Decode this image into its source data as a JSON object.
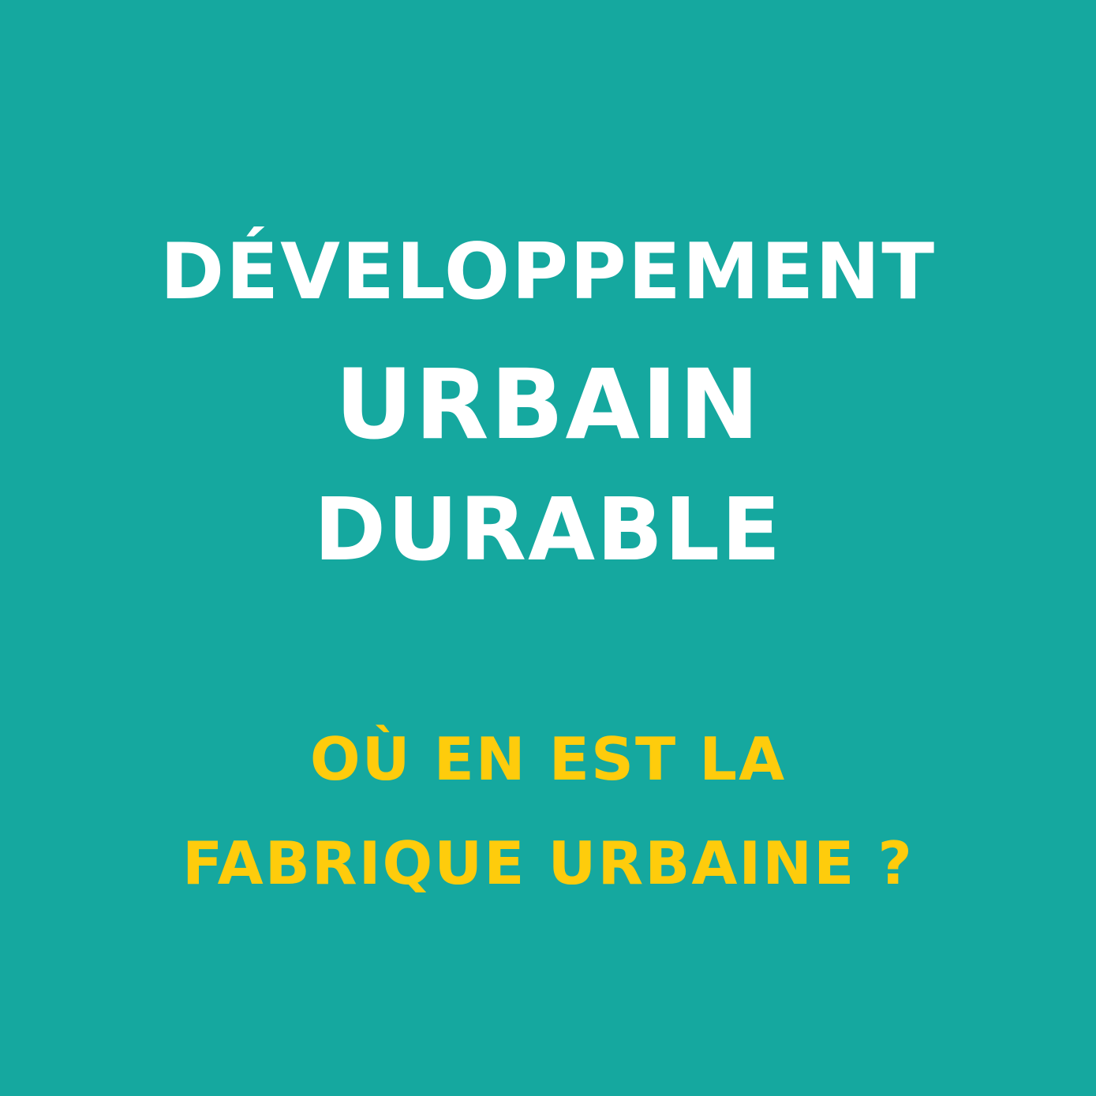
{
  "title": {
    "line1": "DÉVELOPPEMENT",
    "line2": "URBAIN",
    "line3": "DURABLE"
  },
  "subtitle": {
    "line1": "OÙ EN EST LA",
    "line2": "FABRIQUE URBAINE ?"
  },
  "colors": {
    "background": "#15a89f",
    "title": "#ffffff",
    "subtitle": "#fecc0c"
  }
}
